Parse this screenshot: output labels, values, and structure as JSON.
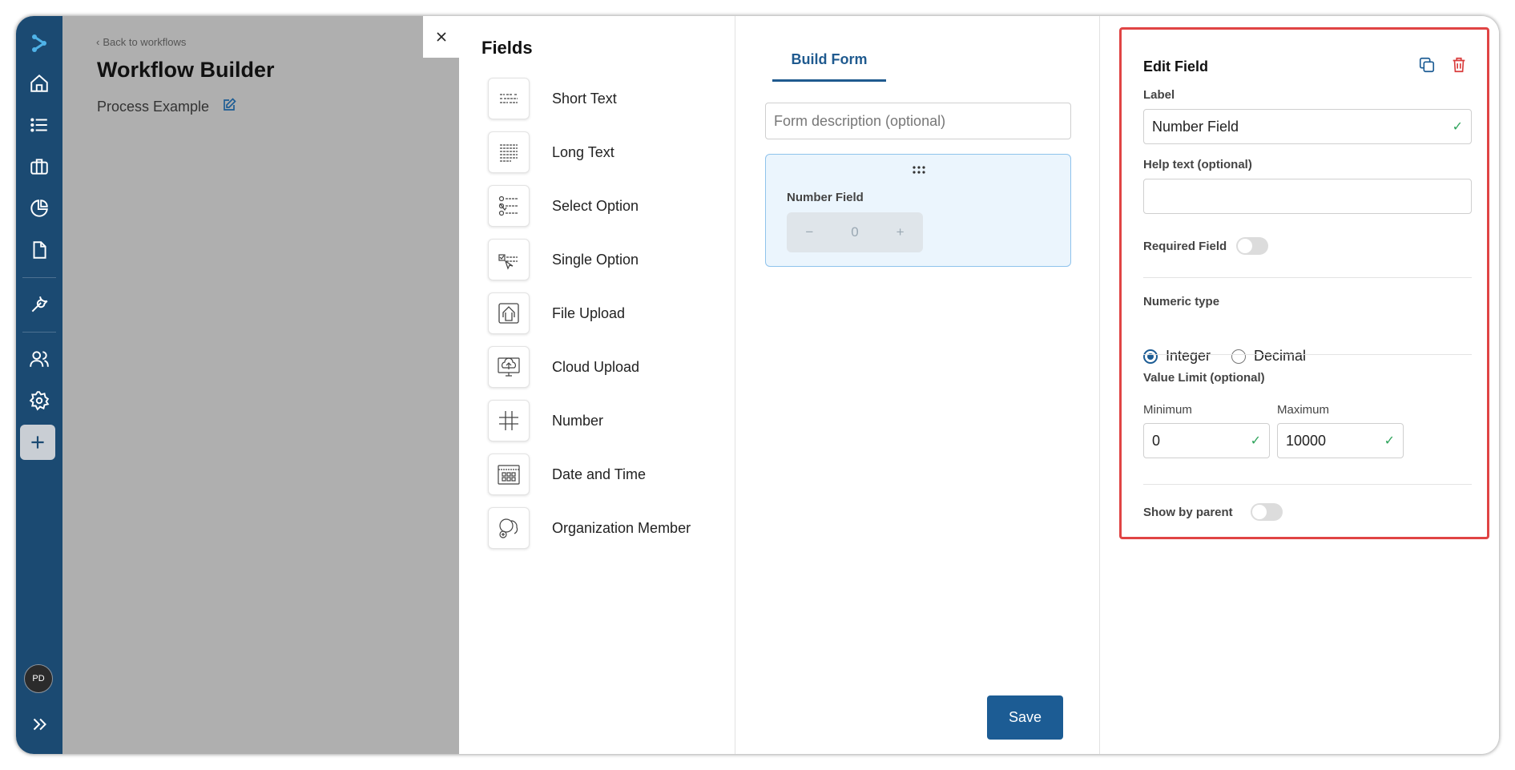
{
  "back_link": "Back to workflows",
  "title": "Workflow Builder",
  "process_name": "Process Example",
  "avatar_initials": "PD",
  "fields_panel": {
    "heading": "Fields",
    "items": [
      {
        "label": "Short Text",
        "icon": "short-text-icon"
      },
      {
        "label": "Long Text",
        "icon": "long-text-icon"
      },
      {
        "label": "Select Option",
        "icon": "select-option-icon"
      },
      {
        "label": "Single Option",
        "icon": "single-option-icon"
      },
      {
        "label": "File Upload",
        "icon": "file-upload-icon"
      },
      {
        "label": "Cloud Upload",
        "icon": "cloud-upload-icon"
      },
      {
        "label": "Number",
        "icon": "number-icon"
      },
      {
        "label": "Date and Time",
        "icon": "calendar-icon"
      },
      {
        "label": "Organization Member",
        "icon": "member-icon"
      }
    ]
  },
  "build": {
    "tab_label": "Build Form",
    "description_placeholder": "Form description (optional)",
    "card": {
      "label": "Number Field",
      "minus": "−",
      "value": "0",
      "plus": "+"
    },
    "save_label": "Save"
  },
  "edit": {
    "title": "Edit Field",
    "label_caption": "Label",
    "label_value": "Number Field",
    "help_caption": "Help text (optional)",
    "help_value": "",
    "required_caption": "Required Field",
    "numeric_caption": "Numeric type",
    "integer_label": "Integer",
    "decimal_label": "Decimal",
    "value_limit_caption": "Value Limit (optional)",
    "minimum_caption": "Minimum",
    "minimum_value": "0",
    "maximum_caption": "Maximum",
    "maximum_value": "10000",
    "show_parent_caption": "Show by parent"
  },
  "colors": {
    "sidebar": "#1b4a72",
    "accent": "#1c5c94",
    "highlight_border": "#e04444",
    "check": "#2fa45c"
  }
}
